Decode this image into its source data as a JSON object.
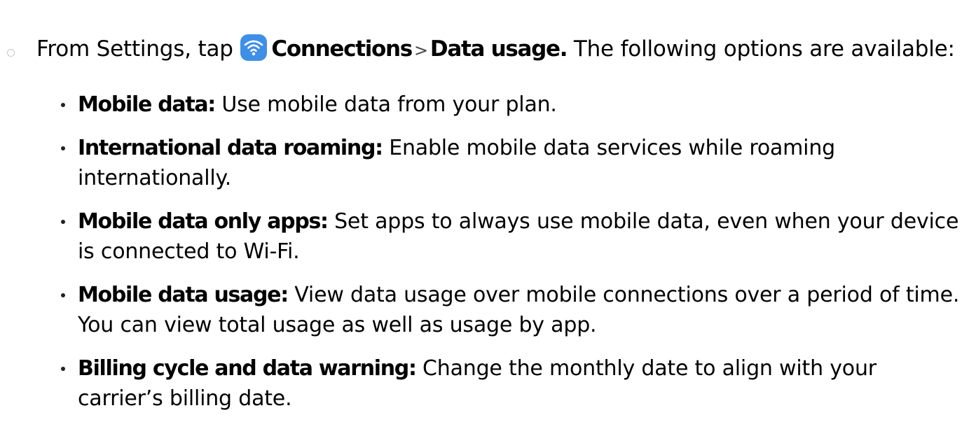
{
  "step": {
    "prefix": "From Settings, tap",
    "icon": "wifi-icon",
    "icon_color": "#3f8fe6",
    "menu": "Connections",
    "separator": ">",
    "submenu": "Data usage.",
    "suffix": "The following options are available:"
  },
  "options": [
    {
      "term": "Mobile data:",
      "desc": "Use mobile data from your plan."
    },
    {
      "term": "International data roaming:",
      "desc": "Enable mobile data services while roaming internationally."
    },
    {
      "term": "Mobile data only apps:",
      "desc": "Set apps to always use mobile data, even when your device is connected to Wi-Fi."
    },
    {
      "term": "Mobile data usage:",
      "desc": "View data usage over mobile connections over a period of time. You can view total usage as well as usage by app."
    },
    {
      "term": "Billing cycle and data warning:",
      "desc": "Change the monthly date to align with your carrier’s billing date."
    }
  ]
}
